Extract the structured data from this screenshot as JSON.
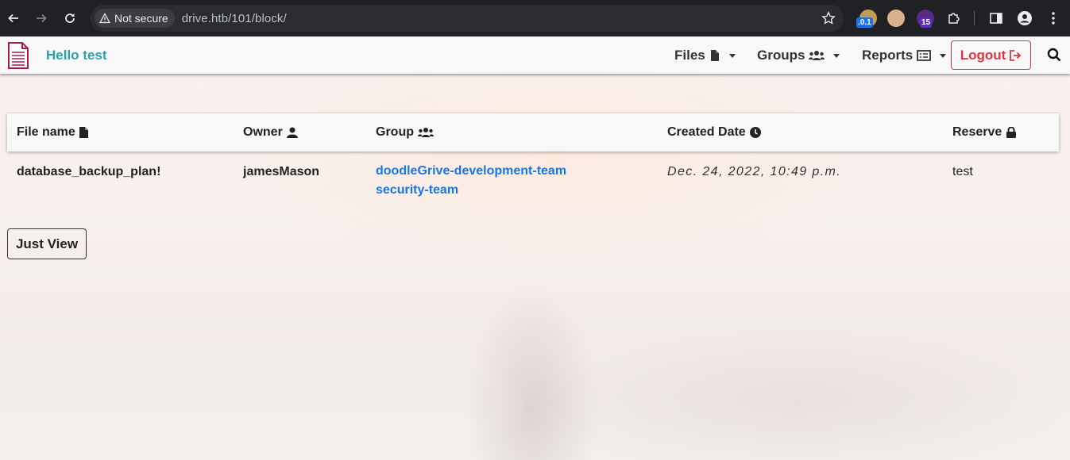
{
  "browser": {
    "security_label": "Not secure",
    "url": "drive.htb/101/block/",
    "ext_badge_1": ".0.1",
    "ext_badge_2": "15"
  },
  "navbar": {
    "greeting": "Hello test",
    "menus": [
      {
        "label": "Files",
        "icon": "file-icon"
      },
      {
        "label": "Groups",
        "icon": "users-icon"
      },
      {
        "label": "Reports",
        "icon": "list-icon"
      }
    ],
    "logout_label": "Logout"
  },
  "table": {
    "headers": {
      "file_name": "File name",
      "owner": "Owner",
      "group": "Group",
      "created_date": "Created Date",
      "reserve": "Reserve"
    },
    "rows": [
      {
        "file_name": "database_backup_plan!",
        "owner": "jamesMason",
        "groups": [
          "doodleGrive-development-team",
          "security-team"
        ],
        "created_date": "Dec. 24, 2022, 10:49 p.m.",
        "reserve": "test"
      }
    ]
  },
  "actions": {
    "just_view_label": "Just View"
  },
  "colors": {
    "brand_teal": "#2aa0a8",
    "logout_red": "#dc3545",
    "link_blue": "#1877e6",
    "brand_icon": "#b0174a"
  }
}
